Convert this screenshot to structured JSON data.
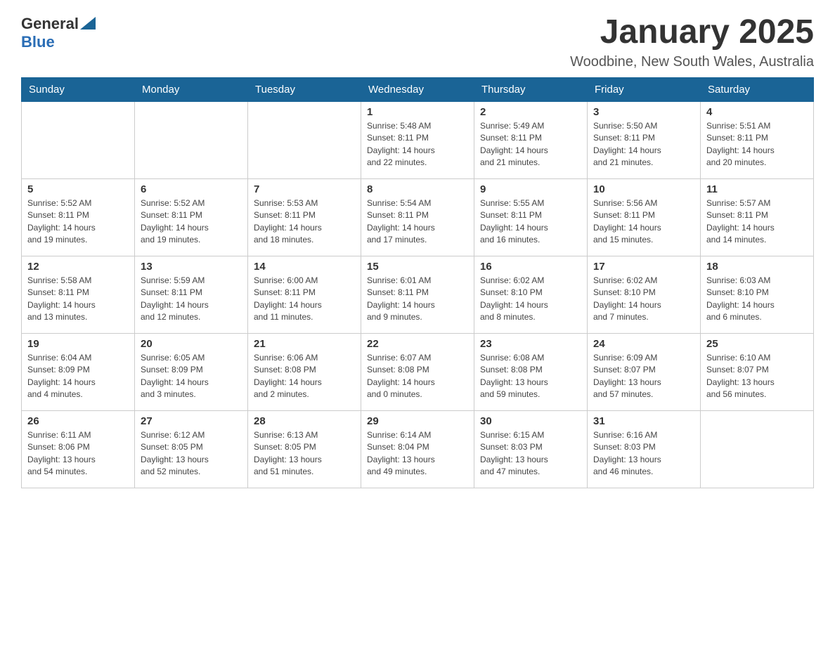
{
  "header": {
    "logo_general": "General",
    "logo_blue": "Blue",
    "month_title": "January 2025",
    "location": "Woodbine, New South Wales, Australia"
  },
  "weekdays": [
    "Sunday",
    "Monday",
    "Tuesday",
    "Wednesday",
    "Thursday",
    "Friday",
    "Saturday"
  ],
  "weeks": [
    [
      {
        "day": "",
        "info": ""
      },
      {
        "day": "",
        "info": ""
      },
      {
        "day": "",
        "info": ""
      },
      {
        "day": "1",
        "info": "Sunrise: 5:48 AM\nSunset: 8:11 PM\nDaylight: 14 hours\nand 22 minutes."
      },
      {
        "day": "2",
        "info": "Sunrise: 5:49 AM\nSunset: 8:11 PM\nDaylight: 14 hours\nand 21 minutes."
      },
      {
        "day": "3",
        "info": "Sunrise: 5:50 AM\nSunset: 8:11 PM\nDaylight: 14 hours\nand 21 minutes."
      },
      {
        "day": "4",
        "info": "Sunrise: 5:51 AM\nSunset: 8:11 PM\nDaylight: 14 hours\nand 20 minutes."
      }
    ],
    [
      {
        "day": "5",
        "info": "Sunrise: 5:52 AM\nSunset: 8:11 PM\nDaylight: 14 hours\nand 19 minutes."
      },
      {
        "day": "6",
        "info": "Sunrise: 5:52 AM\nSunset: 8:11 PM\nDaylight: 14 hours\nand 19 minutes."
      },
      {
        "day": "7",
        "info": "Sunrise: 5:53 AM\nSunset: 8:11 PM\nDaylight: 14 hours\nand 18 minutes."
      },
      {
        "day": "8",
        "info": "Sunrise: 5:54 AM\nSunset: 8:11 PM\nDaylight: 14 hours\nand 17 minutes."
      },
      {
        "day": "9",
        "info": "Sunrise: 5:55 AM\nSunset: 8:11 PM\nDaylight: 14 hours\nand 16 minutes."
      },
      {
        "day": "10",
        "info": "Sunrise: 5:56 AM\nSunset: 8:11 PM\nDaylight: 14 hours\nand 15 minutes."
      },
      {
        "day": "11",
        "info": "Sunrise: 5:57 AM\nSunset: 8:11 PM\nDaylight: 14 hours\nand 14 minutes."
      }
    ],
    [
      {
        "day": "12",
        "info": "Sunrise: 5:58 AM\nSunset: 8:11 PM\nDaylight: 14 hours\nand 13 minutes."
      },
      {
        "day": "13",
        "info": "Sunrise: 5:59 AM\nSunset: 8:11 PM\nDaylight: 14 hours\nand 12 minutes."
      },
      {
        "day": "14",
        "info": "Sunrise: 6:00 AM\nSunset: 8:11 PM\nDaylight: 14 hours\nand 11 minutes."
      },
      {
        "day": "15",
        "info": "Sunrise: 6:01 AM\nSunset: 8:11 PM\nDaylight: 14 hours\nand 9 minutes."
      },
      {
        "day": "16",
        "info": "Sunrise: 6:02 AM\nSunset: 8:10 PM\nDaylight: 14 hours\nand 8 minutes."
      },
      {
        "day": "17",
        "info": "Sunrise: 6:02 AM\nSunset: 8:10 PM\nDaylight: 14 hours\nand 7 minutes."
      },
      {
        "day": "18",
        "info": "Sunrise: 6:03 AM\nSunset: 8:10 PM\nDaylight: 14 hours\nand 6 minutes."
      }
    ],
    [
      {
        "day": "19",
        "info": "Sunrise: 6:04 AM\nSunset: 8:09 PM\nDaylight: 14 hours\nand 4 minutes."
      },
      {
        "day": "20",
        "info": "Sunrise: 6:05 AM\nSunset: 8:09 PM\nDaylight: 14 hours\nand 3 minutes."
      },
      {
        "day": "21",
        "info": "Sunrise: 6:06 AM\nSunset: 8:08 PM\nDaylight: 14 hours\nand 2 minutes."
      },
      {
        "day": "22",
        "info": "Sunrise: 6:07 AM\nSunset: 8:08 PM\nDaylight: 14 hours\nand 0 minutes."
      },
      {
        "day": "23",
        "info": "Sunrise: 6:08 AM\nSunset: 8:08 PM\nDaylight: 13 hours\nand 59 minutes."
      },
      {
        "day": "24",
        "info": "Sunrise: 6:09 AM\nSunset: 8:07 PM\nDaylight: 13 hours\nand 57 minutes."
      },
      {
        "day": "25",
        "info": "Sunrise: 6:10 AM\nSunset: 8:07 PM\nDaylight: 13 hours\nand 56 minutes."
      }
    ],
    [
      {
        "day": "26",
        "info": "Sunrise: 6:11 AM\nSunset: 8:06 PM\nDaylight: 13 hours\nand 54 minutes."
      },
      {
        "day": "27",
        "info": "Sunrise: 6:12 AM\nSunset: 8:05 PM\nDaylight: 13 hours\nand 52 minutes."
      },
      {
        "day": "28",
        "info": "Sunrise: 6:13 AM\nSunset: 8:05 PM\nDaylight: 13 hours\nand 51 minutes."
      },
      {
        "day": "29",
        "info": "Sunrise: 6:14 AM\nSunset: 8:04 PM\nDaylight: 13 hours\nand 49 minutes."
      },
      {
        "day": "30",
        "info": "Sunrise: 6:15 AM\nSunset: 8:03 PM\nDaylight: 13 hours\nand 47 minutes."
      },
      {
        "day": "31",
        "info": "Sunrise: 6:16 AM\nSunset: 8:03 PM\nDaylight: 13 hours\nand 46 minutes."
      },
      {
        "day": "",
        "info": ""
      }
    ]
  ]
}
